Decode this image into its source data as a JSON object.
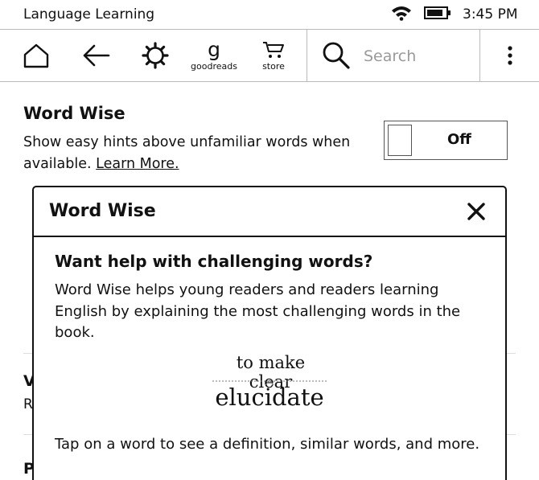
{
  "status_bar": {
    "title": "Language Learning",
    "time": "3:45 PM"
  },
  "toolbar": {
    "goodreads_letter": "g",
    "goodreads_label": "goodreads",
    "store_label": "store",
    "search_placeholder": "Search",
    "icons": [
      "home-icon",
      "back-icon",
      "settings-icon",
      "goodreads-icon",
      "cart-icon",
      "search-icon",
      "more-icon"
    ]
  },
  "setting": {
    "title": "Word Wise",
    "description": "Show easy hints above unfamiliar words when available.",
    "link": "Learn More.",
    "toggle_state": "Off"
  },
  "background_fragments": {
    "frag1": "V",
    "frag2": "R",
    "frag3": "P"
  },
  "dialog": {
    "title": "Word Wise",
    "heading": "Want help with challenging words?",
    "body": "Word Wise helps young readers and readers learning English by explaining the most challenging words in the book.",
    "hint": "to make clear",
    "word": "elucidate",
    "footer": "Tap on a word to see a definition, similar words, and more."
  }
}
